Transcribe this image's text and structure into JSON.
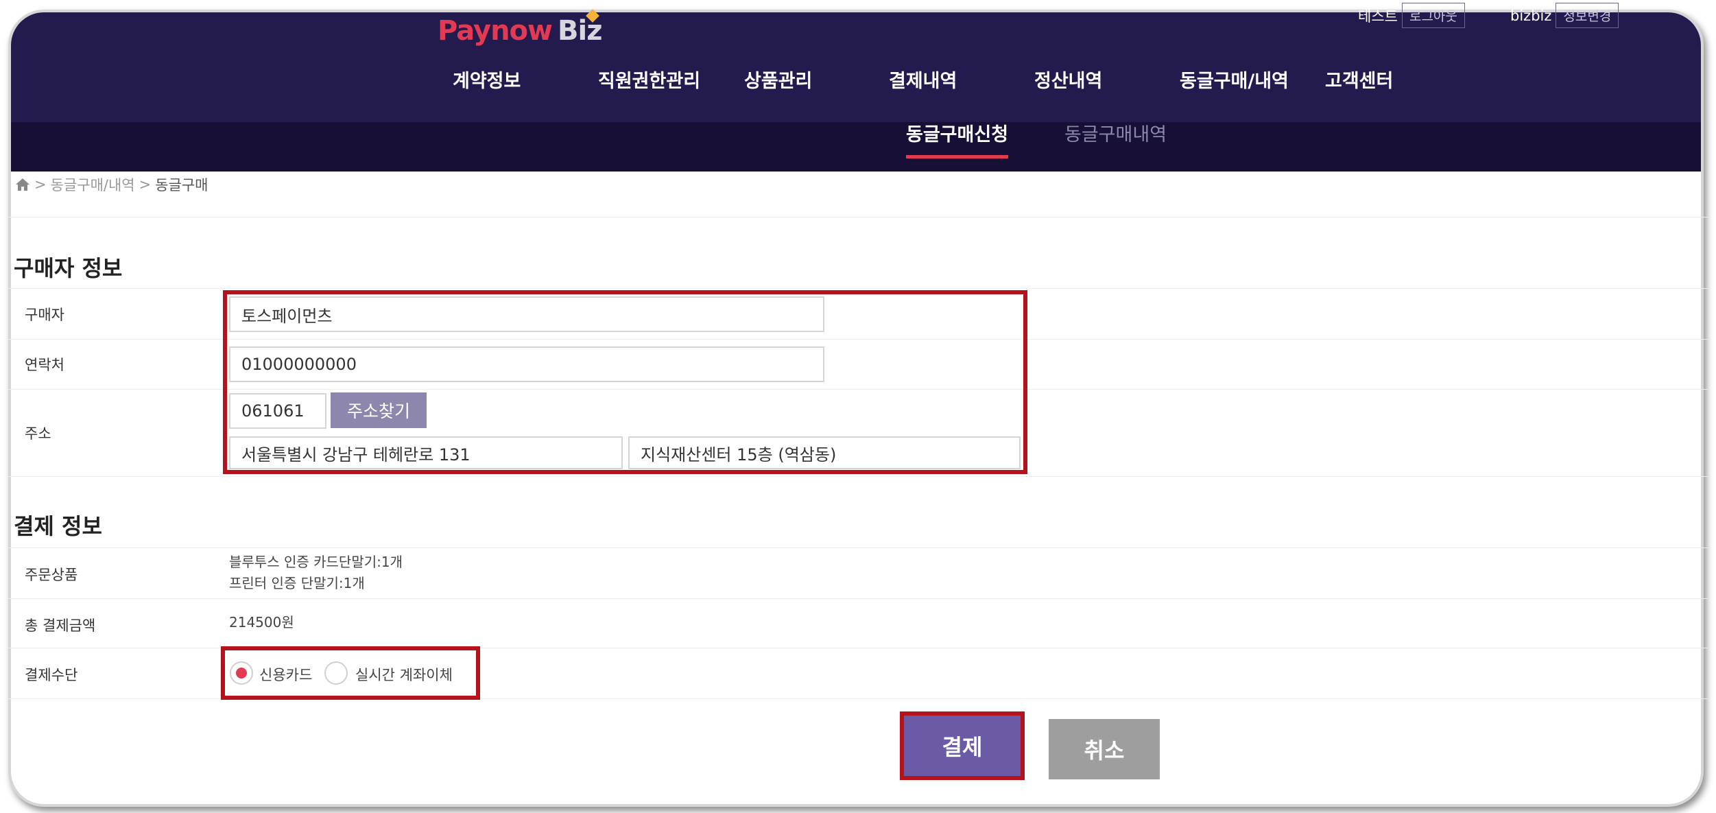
{
  "header": {
    "logo_part1": "Paynow",
    "logo_part2": "Biz",
    "user1_name": "테스트",
    "logout_label": "로그아웃",
    "user2_name": "bizbiz",
    "profile_edit_label": "정보변경"
  },
  "menu": [
    "계약정보",
    "직원권한관리",
    "상품관리",
    "결제내역",
    "정산내역",
    "동글구매/내역",
    "고객센터"
  ],
  "submenu": {
    "active": "동글구매신청",
    "inactive": "동글구매내역"
  },
  "breadcrumb": {
    "parent": "동글구매/내역",
    "current": "동글구매",
    "separator": ">"
  },
  "buyer_section": {
    "title": "구매자 정보",
    "buyer_label": "구매자",
    "buyer_value": "토스페이먼츠",
    "phone_label": "연락처",
    "phone_value": "01000000000",
    "address_label": "주소",
    "postcode_value": "061061",
    "find_address_label": "주소찾기",
    "address1_value": "서울특별시 강남구 테헤란로 131",
    "address2_value": "지식재산센터 15층 (역삼동)"
  },
  "payment_section": {
    "title": "결제 정보",
    "order_label": "주문상품",
    "order_items": [
      "블루투스 인증 카드단말기:1개",
      "프린터 인증 단말기:1개"
    ],
    "total_label": "총 결제금액",
    "total_value": "214500원",
    "method_label": "결제수단",
    "method_options": [
      "신용카드",
      "실시간 계좌이체"
    ],
    "selected_method": "신용카드"
  },
  "buttons": {
    "pay": "결제",
    "cancel": "취소"
  },
  "colors": {
    "nav_bg": "#231a4e",
    "subnav_bg": "#170f35",
    "accent": "#e23a52",
    "highlight": "#b5121b",
    "pay_button": "#6b5aa6"
  }
}
